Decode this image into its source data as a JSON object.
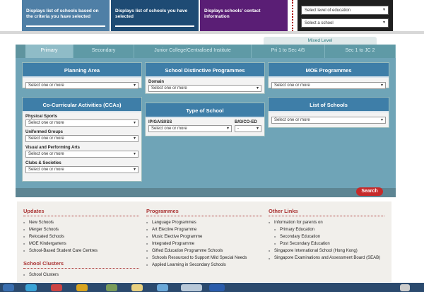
{
  "top": {
    "tile1": "Displays list of schools based on the criteria you have selected",
    "tile2": "Displays list of schools you have selected",
    "tile3": "Displays schools' contact information",
    "select_level": "Select level of education",
    "select_school": "Select a school"
  },
  "mixed_level": "Mixed Level",
  "tabs": [
    "Primary",
    "Secondary",
    "Junior College/Centralised Institute",
    "Pri 1 to Sec 4/5",
    "Sec 1 to JC 2"
  ],
  "boxes": {
    "planning": {
      "title": "Planning Area",
      "value": "Select one or more"
    },
    "distinctive": {
      "title": "School Distinctive Programmes",
      "label": "Domain",
      "value": "Select one or more"
    },
    "moe": {
      "title": "MOE Programmes",
      "value": "Select one or more"
    },
    "cca": {
      "title": "Co-Curricular Activities (CCAs)",
      "groups": [
        {
          "label": "Physical Sports",
          "value": "Select one or more"
        },
        {
          "label": "Uniformed Groups",
          "value": "Select one or more"
        },
        {
          "label": "Visual and Performing Arts",
          "value": "Select one or more"
        },
        {
          "label": "Clubs & Societies",
          "value": "Select one or more"
        }
      ]
    },
    "type": {
      "title": "Type of School",
      "label1": "IP/GA/SI/SS",
      "value1": "Select one or more",
      "label2": "B/G/CO-ED",
      "value2": "-"
    },
    "list": {
      "title": "List of Schools",
      "value": "Select one or more"
    }
  },
  "search_label": "Search",
  "links": {
    "updates": {
      "title": "Updates",
      "items": [
        "New Schools",
        "Merger Schools",
        "Relocated Schools",
        "MOE Kindergartens",
        "School-Based Student Care Centres"
      ]
    },
    "clusters": {
      "title": "School Clusters",
      "items": [
        "School Clusters"
      ]
    },
    "programmes": {
      "title": "Programmes",
      "items": [
        "Language Programmes",
        "Art Elective Programme",
        "Music Elective Programme",
        "Integrated Programme",
        "Gifted Education Programme Schools",
        "Schools Resourced to Support Mild Special Needs",
        "Applied Learning in Secondary Schools"
      ]
    },
    "other": {
      "title": "Other Links",
      "parents": "Information for parents on",
      "sub": [
        "Primary Education",
        "Secondary Education",
        "Post Secondary Education"
      ],
      "items": [
        "Singapore International School (Hong Kong)",
        "Singapore Examinations and Assessment Board (SEAB)"
      ]
    }
  }
}
